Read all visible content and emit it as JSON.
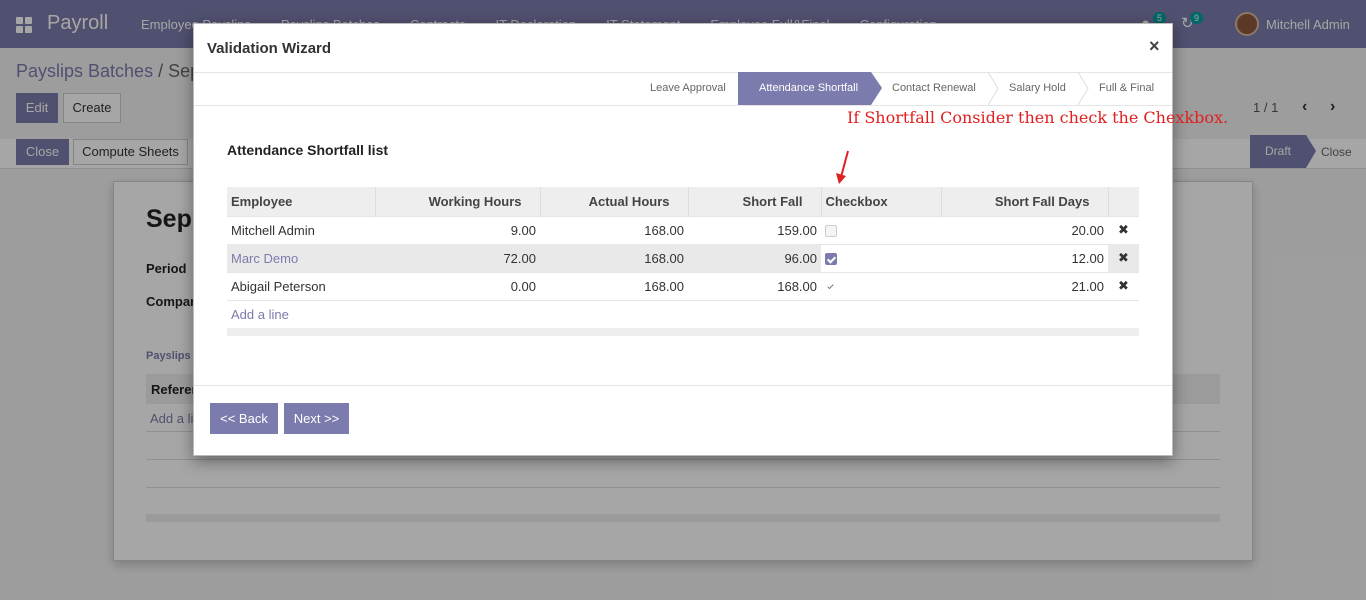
{
  "navbar": {
    "brand": "Payroll",
    "menu": [
      "Employee Payslips",
      "Payslips Batches",
      "Contracts",
      "IT Declaration",
      "IT Statement",
      "Employee Full&Final",
      "Configuration"
    ],
    "messages_count": "5",
    "activities_count": "9",
    "user_name": "Mitchell Admin",
    "accent_color": "#7c7bad"
  },
  "control_panel": {
    "breadcrumb_parent": "Payslips Batches",
    "breadcrumb_separator": " / ",
    "breadcrumb_current": "Sep",
    "edit_label": "Edit",
    "create_label": "Create",
    "pager": "1 / 1",
    "close_label": "Close",
    "compute_label": "Compute Sheets",
    "status_draft": "Draft",
    "status_close": "Close"
  },
  "sheet": {
    "title": "Sep",
    "period_label": "Period",
    "company_label": "Compar",
    "tab_label": "Payslips",
    "col_reference": "Referer",
    "add_line": "Add a li"
  },
  "wizard": {
    "title": "Validation Wizard",
    "close_icon": "×",
    "steps": [
      "Leave Approval",
      "Attendance Shortfall",
      "Contact Renewal",
      "Salary Hold",
      "Full & Final"
    ],
    "active_step": "Attendance Shortfall",
    "annotation": "If Shortfall Consider then check the Chexkbox.",
    "list_title": "Attendance Shortfall list",
    "columns": {
      "employee": "Employee",
      "working_hours": "Working Hours",
      "actual_hours": "Actual Hours",
      "short_fall": "Short Fall",
      "checkbox": "Checkbox",
      "short_fall_days": "Short Fall Days"
    },
    "rows": [
      {
        "employee": "Mitchell Admin",
        "working_hours": "9.00",
        "actual_hours": "168.00",
        "short_fall": "159.00",
        "checked": false,
        "short_fall_days": "20.00"
      },
      {
        "employee": "Marc Demo",
        "working_hours": "72.00",
        "actual_hours": "168.00",
        "short_fall": "96.00",
        "checked": true,
        "short_fall_days": "12.00"
      },
      {
        "employee": "Abigail Peterson",
        "working_hours": "0.00",
        "actual_hours": "168.00",
        "short_fall": "168.00",
        "checked": true,
        "short_fall_days": "21.00"
      }
    ],
    "add_line": "Add a line",
    "delete_icon": "✖",
    "back_label": "<< Back",
    "next_label": "Next >>"
  }
}
